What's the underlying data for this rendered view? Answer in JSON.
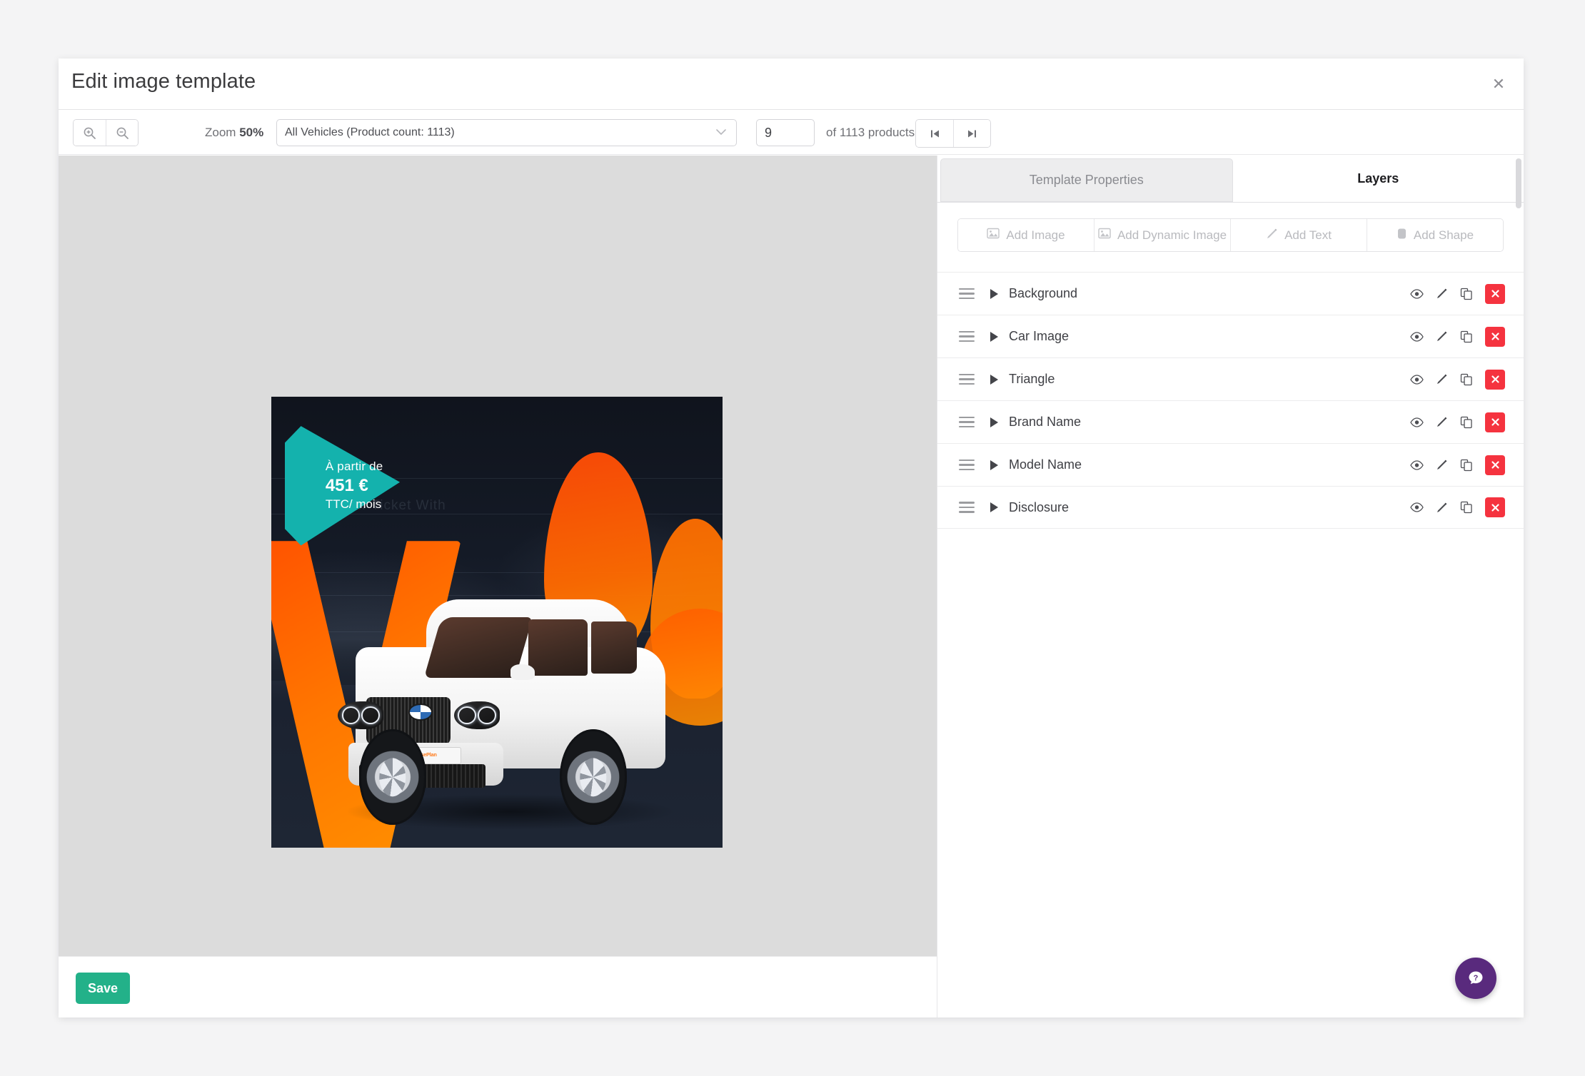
{
  "header": {
    "title": "Edit image template",
    "close_icon": "close-icon"
  },
  "toolbar": {
    "zoom_in_icon": "zoom-in-icon",
    "zoom_out_icon": "zoom-out-icon",
    "zoom_label": "Zoom",
    "zoom_value": "50%",
    "feed_selected": "All Vehicles (Product count: 1113)",
    "chevron_icon": "chevron-down-icon",
    "page_value": "9",
    "page_total": "of 1113 products",
    "first_page_icon": "skip-to-first-icon",
    "last_page_icon": "skip-to-last-icon"
  },
  "panel": {
    "tabs": [
      {
        "label": "Template Properties",
        "active": false
      },
      {
        "label": "Layers",
        "active": true
      }
    ],
    "add_buttons": [
      {
        "label": "Add Image",
        "icon": "image-icon"
      },
      {
        "label": "Add Dynamic Image",
        "icon": "dynamic-image-icon"
      },
      {
        "label": "Add Text",
        "icon": "pencil-icon"
      },
      {
        "label": "Add Shape",
        "icon": "shape-icon"
      }
    ],
    "layer_actions": {
      "visibility_icon": "eye-icon",
      "edit_icon": "pencil-icon",
      "duplicate_icon": "copy-icon",
      "delete_icon": "close-icon"
    },
    "layers": [
      {
        "name": "Background"
      },
      {
        "name": "Car Image"
      },
      {
        "name": "Triangle"
      },
      {
        "name": "Brand Name"
      },
      {
        "name": "Model Name"
      },
      {
        "name": "Disclosure"
      }
    ]
  },
  "canvas": {
    "creative": {
      "badge": {
        "line1": "À partir de",
        "line2": "451 €",
        "line3": "TTC/ mois",
        "color": "#14b2ad"
      },
      "background_sign_text": "Take Your Ticket With",
      "license_plate_text": "LeasePlan",
      "background_color": "#1b2230",
      "accent_color": "#ff6a00"
    }
  },
  "footer": {
    "save_label": "Save",
    "help_icon": "help-question-icon"
  },
  "colors": {
    "save_green": "#23b189",
    "delete_red": "#f5333f",
    "help_purple": "#592a7d",
    "teal": "#14b2ad",
    "orange": "#ff6a00"
  }
}
